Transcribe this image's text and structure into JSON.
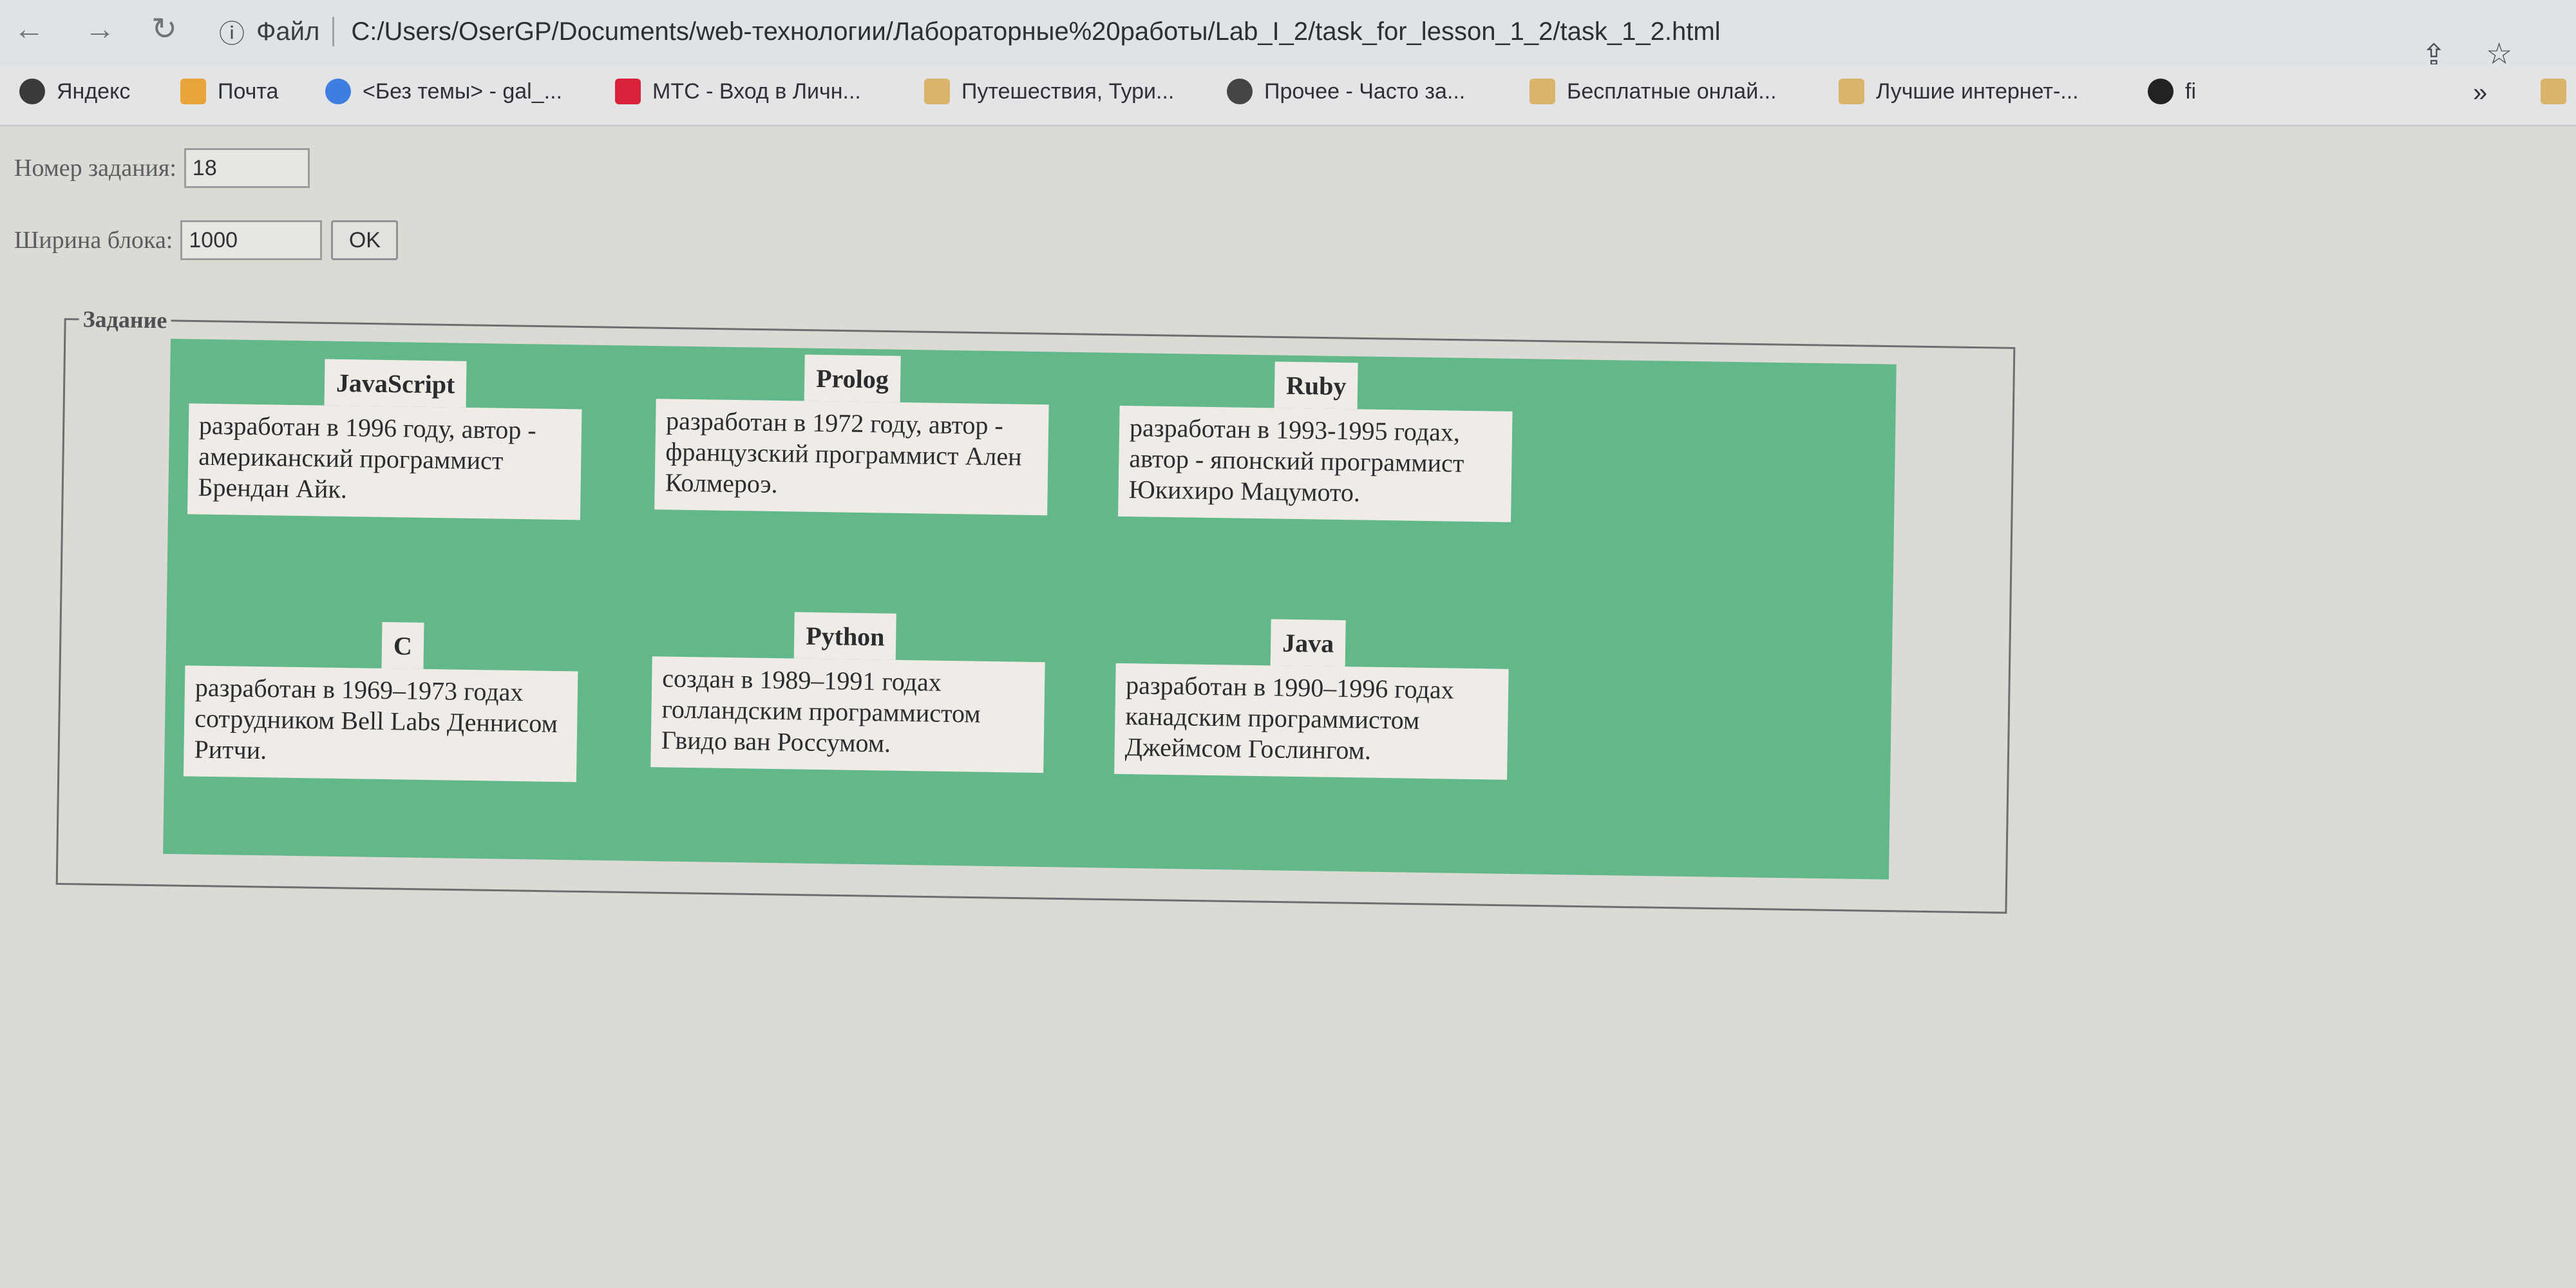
{
  "browser": {
    "file_label": "Файл",
    "url": "C:/Users/OserGP/Documents/web-технологии/Лабораторные%20работы/Lab_I_2/task_for_lesson_1_2/task_1_2.html",
    "bookmarks": [
      {
        "label": "Яндекс",
        "icon": "yandex-icon",
        "color": "#3a3a3a"
      },
      {
        "label": "Почта",
        "icon": "mail-icon",
        "color": "#e8a33a"
      },
      {
        "label": "<Без темы> - gal_...",
        "icon": "at-sign-icon",
        "color": "#3d7ee0"
      },
      {
        "label": "МТС - Вход в Личн...",
        "icon": "mts-icon",
        "color": "#d8223a"
      },
      {
        "label": "Путешествия, Тури...",
        "icon": "folder-icon",
        "color": "#d9b46a"
      },
      {
        "label": "Прочее - Часто за...",
        "icon": "globe-icon",
        "color": "#444"
      },
      {
        "label": "Бесплатные онлай...",
        "icon": "folder-icon",
        "color": "#d9b46a"
      },
      {
        "label": "Лучшие интернет-...",
        "icon": "folder-icon",
        "color": "#d9b46a"
      },
      {
        "label": "fi",
        "icon": "link-icon",
        "color": "#222"
      }
    ],
    "more_label": "»"
  },
  "form": {
    "task_number_label": "Номер задания:",
    "task_number_value": "18",
    "block_width_label": "Ширина блока:",
    "block_width_value": "1000",
    "ok_label": "OK"
  },
  "task": {
    "legend": "Задание",
    "cards": [
      {
        "title": "JavaScript",
        "text": "разработан в 1996 году, автор - американский программист Брендан Айк."
      },
      {
        "title": "Prolog",
        "text": "разработан в 1972 году, автор - французский программист Ален Колмероэ."
      },
      {
        "title": "Ruby",
        "text": "разработан в 1993-1995 годах, автор - японский программист Юкихиро Мацумото."
      },
      {
        "title": "C",
        "text": "разработан в 1969–1973 годах сотрудником Bell Labs Деннисом Ритчи."
      },
      {
        "title": "Python",
        "text": "создан в 1989–1991 годах голландским программистом Гвидо ван Россумом."
      },
      {
        "title": "Java",
        "text": "разработан в 1990–1996 годах канадским программистом Джеймсом Гослингом."
      }
    ]
  },
  "colors": {
    "panel_green": "#63b88a",
    "card_bg": "#efece7"
  }
}
